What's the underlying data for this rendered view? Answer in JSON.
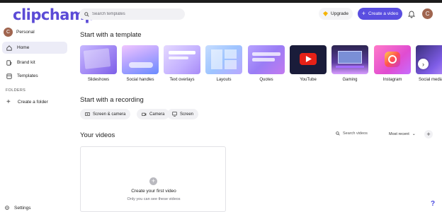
{
  "header": {
    "logo": "clipchamp",
    "search_placeholder": "Search templates",
    "upgrade_label": "Upgrade",
    "create_label": "Create a video",
    "avatar_initial": "C"
  },
  "sidebar": {
    "profile_initial": "C",
    "profile_name": "Personal",
    "items": [
      {
        "label": "Home",
        "icon": "home-icon"
      },
      {
        "label": "Brand kit",
        "icon": "brand-kit-icon"
      },
      {
        "label": "Templates",
        "icon": "templates-icon"
      }
    ],
    "folders_label": "FOLDERS",
    "create_folder_label": "Create a folder",
    "settings_label": "Settings"
  },
  "main": {
    "templates_heading": "Start with a template",
    "templates": [
      {
        "label": "Slideshows"
      },
      {
        "label": "Social handles"
      },
      {
        "label": "Text overlays"
      },
      {
        "label": "Layouts"
      },
      {
        "label": "Quotes"
      },
      {
        "label": "YouTube"
      },
      {
        "label": "Gaming"
      },
      {
        "label": "Instagram"
      },
      {
        "label": "Social media"
      }
    ],
    "recording_heading": "Start with a recording",
    "recordings": [
      {
        "label": "Screen & camera"
      },
      {
        "label": "Camera"
      },
      {
        "label": "Screen"
      }
    ],
    "videos_heading": "Your videos",
    "search_videos_placeholder": "Search videos",
    "sort_label": "Most recent",
    "empty_title": "Create your first video",
    "empty_subtitle": "Only you can see these videos"
  },
  "colors": {
    "brand": "#5b4bd6",
    "primary_button": "#5a4ee0",
    "avatar": "#a0654f",
    "active_nav": "#ececf7"
  }
}
